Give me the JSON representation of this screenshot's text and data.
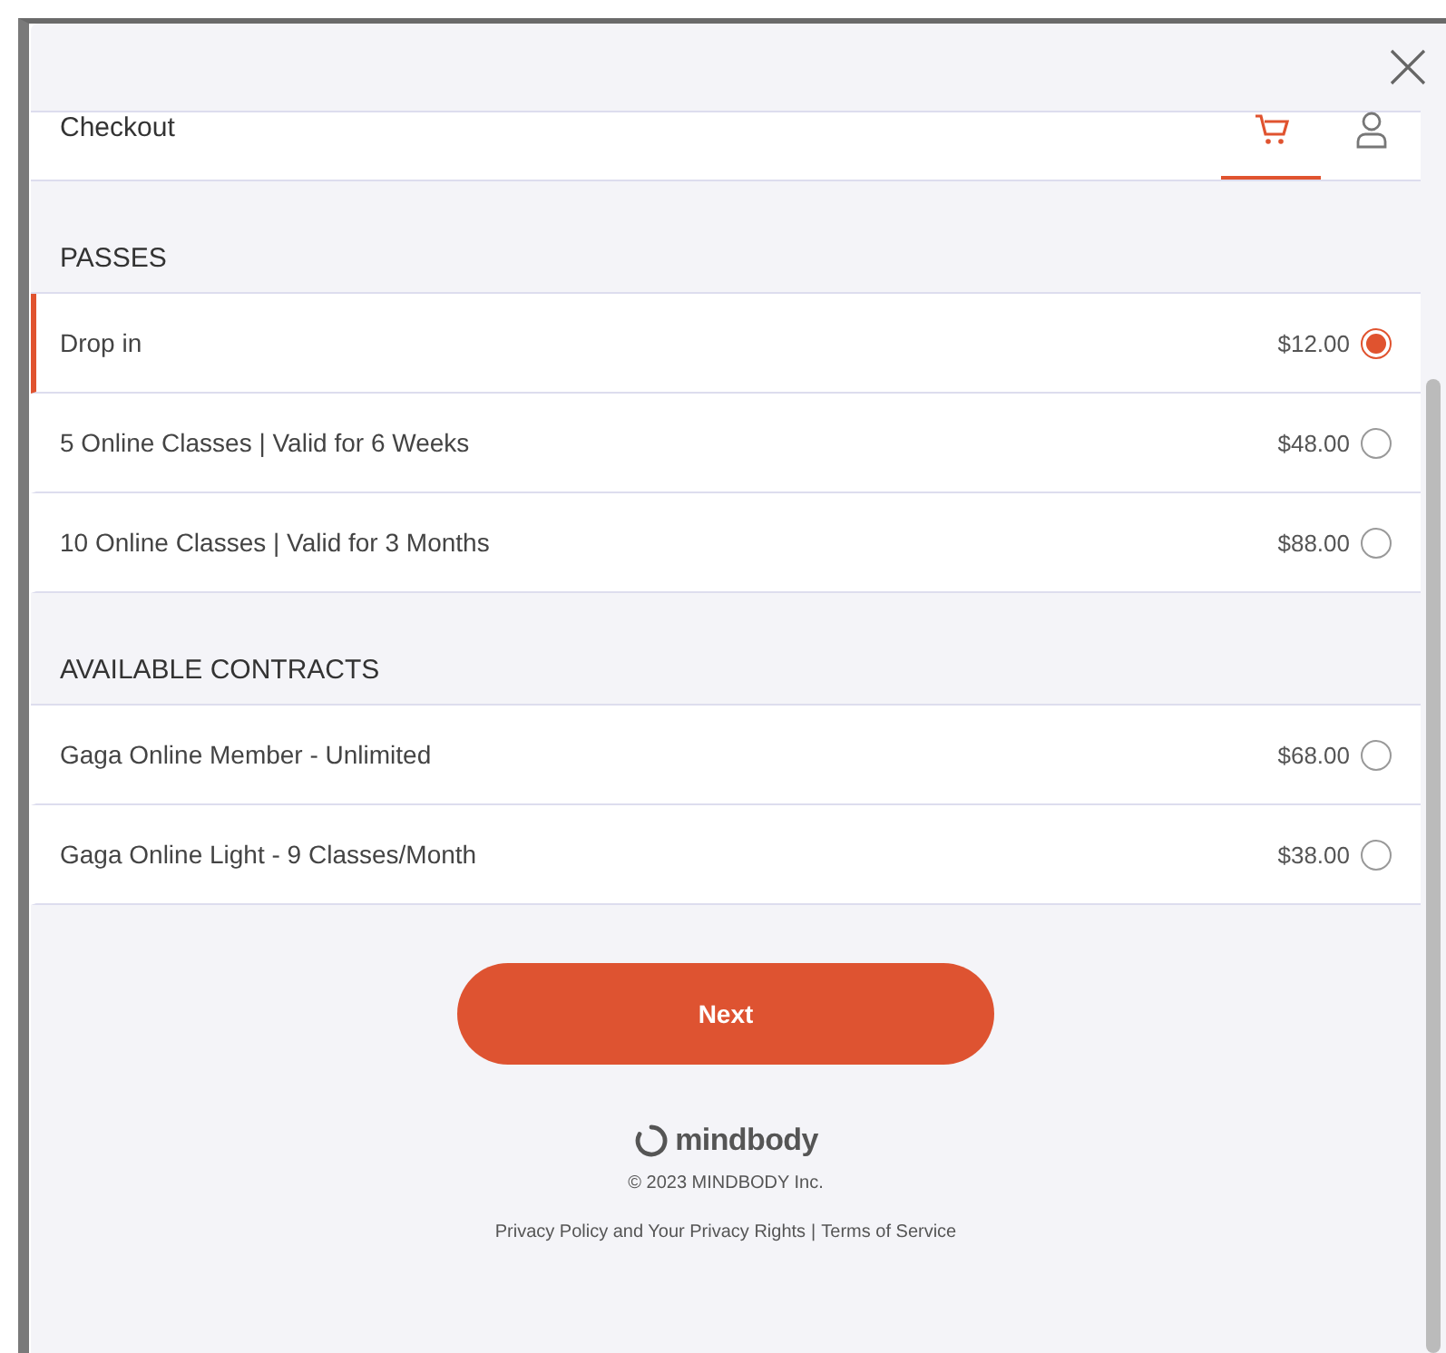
{
  "header": {
    "title": "Checkout",
    "tabs": [
      {
        "kind": "cart",
        "selected": true
      },
      {
        "kind": "person",
        "selected": false
      }
    ]
  },
  "sections": [
    {
      "title": "PASSES",
      "items": [
        {
          "name": "Drop in",
          "price": "$12.00",
          "selected": true
        },
        {
          "name": "5 Online Classes | Valid for 6 Weeks",
          "price": "$48.00",
          "selected": false
        },
        {
          "name": "10 Online Classes | Valid for 3 Months",
          "price": "$88.00",
          "selected": false
        }
      ]
    },
    {
      "title": "AVAILABLE CONTRACTS",
      "items": [
        {
          "name": "Gaga Online Member - Unlimited",
          "price": "$68.00",
          "selected": false
        },
        {
          "name": "Gaga Online Light - 9 Classes/Month",
          "price": "$38.00",
          "selected": false
        }
      ]
    }
  ],
  "footer": {
    "button": "Next",
    "brand": "mindbody",
    "copyright": "© 2023 MINDBODY Inc.",
    "links": [
      "Privacy Policy and Your Privacy Rights",
      "Terms of Service"
    ],
    "separator": "|"
  }
}
